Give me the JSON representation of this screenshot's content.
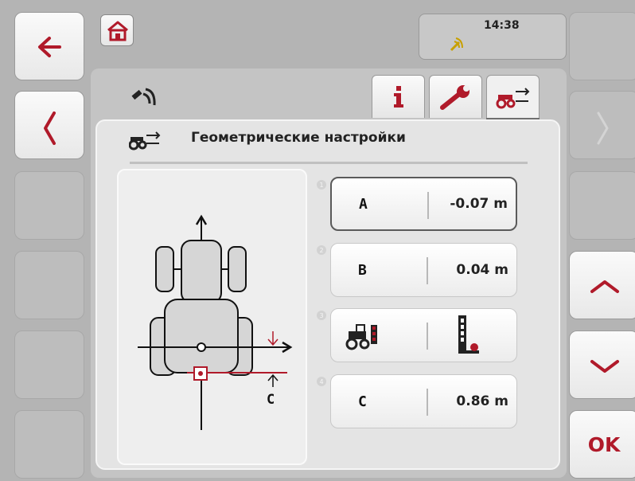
{
  "status": {
    "time": "14:38"
  },
  "panel": {
    "title": "Геометрические настройки"
  },
  "tabs": [
    {
      "icon": "info-icon",
      "selected": false
    },
    {
      "icon": "wrench-icon",
      "selected": false
    },
    {
      "icon": "tractor-geometry-icon",
      "selected": true
    }
  ],
  "diagram": {
    "label_c": "C"
  },
  "settings": [
    {
      "index": "1",
      "label": "A",
      "value": "-0.07 m",
      "focused": true
    },
    {
      "index": "2",
      "label": "B",
      "value": "0.04 m",
      "focused": false
    },
    {
      "index": "3",
      "icon": "tractor-lights-icon",
      "value_icon": "implement-hitch-icon",
      "focused": false
    },
    {
      "index": "4",
      "label": "C",
      "value": "0.86 m",
      "focused": false
    }
  ],
  "softkeys": {
    "ok_label": "OK"
  },
  "colors": {
    "accent": "#b01a2a",
    "background": "#b4b4b4",
    "panel": "#e4e4e4"
  }
}
